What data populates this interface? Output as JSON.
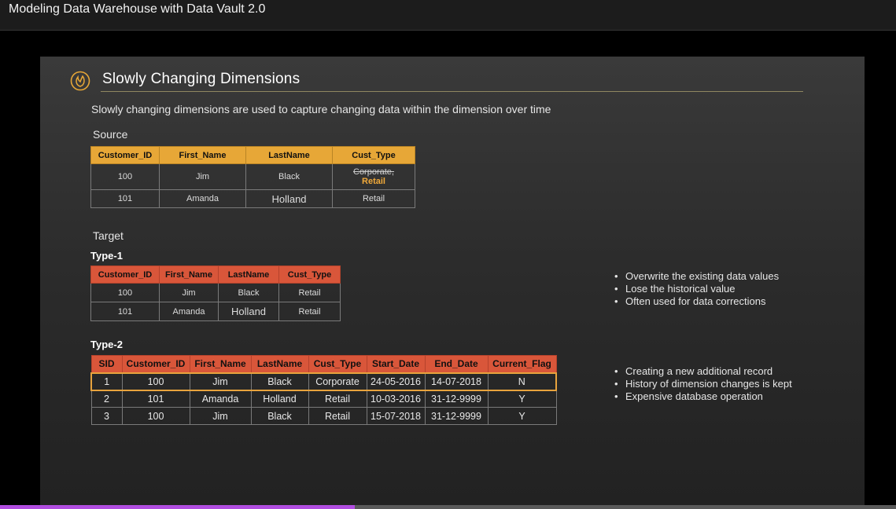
{
  "video": {
    "title": "Modeling Data Warehouse with Data Vault 2.0",
    "progress": 0.396
  },
  "slide": {
    "title": "Slowly Changing Dimensions",
    "logo_icon": "flame-logo-icon",
    "accent_color": "#e7a737",
    "intro": "Slowly changing dimensions are used to capture changing data within the dimension over time",
    "source_label": "Source",
    "target_label": "Target",
    "type1_label": "Type-1",
    "type2_label": "Type-2"
  },
  "source": {
    "headers": [
      "Customer_ID",
      "First_Name",
      "LastName",
      "Cust_Type"
    ],
    "row1": {
      "id": "100",
      "first": "Jim",
      "last": "Black",
      "old_type": "Corporate,",
      "new_type": "Retail"
    },
    "row2": {
      "id": "101",
      "first": "Amanda",
      "last": "Holland",
      "type": "Retail"
    }
  },
  "type1": {
    "headers": [
      "Customer_ID",
      "First_Name",
      "LastName",
      "Cust_Type"
    ],
    "rows": [
      [
        "100",
        "Jim",
        "Black",
        "Retail"
      ],
      [
        "101",
        "Amanda",
        "Holland",
        "Retail"
      ]
    ],
    "notes": [
      "Overwrite the existing data values",
      "Lose the historical value",
      "Often used for data corrections"
    ]
  },
  "type2": {
    "headers": [
      "SID",
      "Customer_ID",
      "First_Name",
      "LastName",
      "Cust_Type",
      "Start_Date",
      "End_Date",
      "Current_Flag"
    ],
    "rows": [
      [
        "1",
        "100",
        "Jim",
        "Black",
        "Corporate",
        "24-05-2016",
        "14-07-2018",
        "N"
      ],
      [
        "2",
        "101",
        "Amanda",
        "Holland",
        "Retail",
        "10-03-2016",
        "31-12-9999",
        "Y"
      ],
      [
        "3",
        "100",
        "Jim",
        "Black",
        "Retail",
        "15-07-2018",
        "31-12-9999",
        "Y"
      ]
    ],
    "notes": [
      "Creating a new additional record",
      "History of dimension changes is kept",
      "Expensive database operation"
    ]
  }
}
